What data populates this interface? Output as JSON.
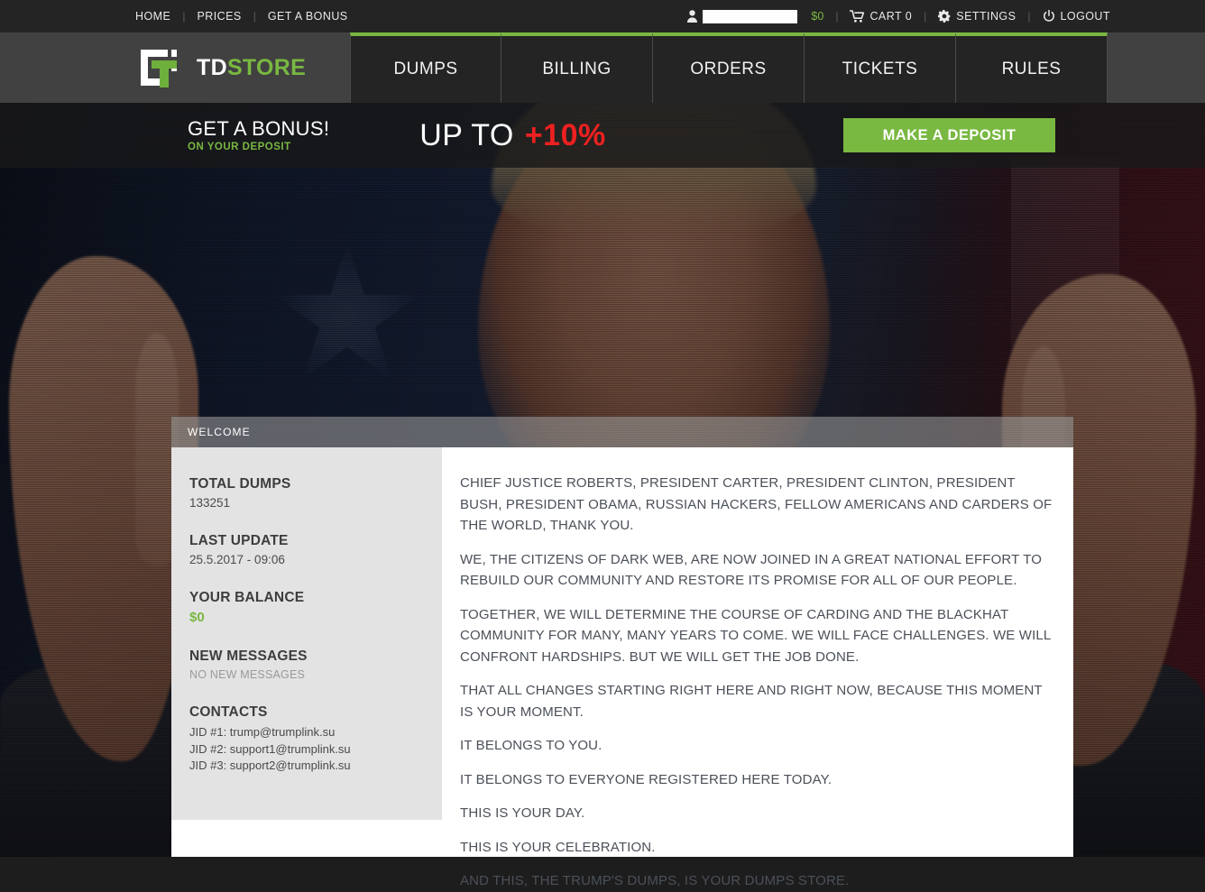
{
  "topbar": {
    "links": [
      {
        "label": "HOME",
        "name": "home"
      },
      {
        "label": "PRICES",
        "name": "prices"
      },
      {
        "label": "GET A BONUS",
        "name": "get-a-bonus"
      }
    ],
    "separator": "|",
    "user": {
      "name_redacted": true,
      "balance": "$0"
    },
    "cart": {
      "label": "CART 0"
    },
    "settings": {
      "label": "SETTINGS"
    },
    "logout": {
      "label": "LOGOUT"
    }
  },
  "logo": {
    "primary": "TD",
    "secondary": "STORE"
  },
  "nav": {
    "tabs": [
      {
        "label": "DUMPS"
      },
      {
        "label": "BILLING"
      },
      {
        "label": "ORDERS"
      },
      {
        "label": "TICKETS"
      },
      {
        "label": "RULES"
      }
    ]
  },
  "banner": {
    "title": "GET A BONUS!",
    "subtitle": "ON YOUR DEPOSIT",
    "upto_label": "UP TO",
    "percent": "+10%",
    "deposit_button": "MAKE A DEPOSIT"
  },
  "panel": {
    "header_title": "WELCOME"
  },
  "sidebar": {
    "blocks": [
      {
        "heading": "TOTAL DUMPS",
        "value": "133251",
        "style": "plain"
      },
      {
        "heading": "LAST UPDATE",
        "value": "25.5.2017 - 09:06",
        "style": "plain"
      },
      {
        "heading": "YOUR BALANCE",
        "value": "$0",
        "style": "green"
      },
      {
        "heading": "NEW MESSAGES",
        "value": "NO NEW MESSAGES",
        "style": "muted"
      }
    ],
    "contacts": {
      "heading": "CONTACTS",
      "lines": [
        "JID #1: trump@trumplink.su",
        "JID #2: support1@trumplink.su",
        "JID #3: support2@trumplink.su"
      ]
    }
  },
  "content": {
    "paragraphs": [
      "CHIEF JUSTICE ROBERTS, PRESIDENT CARTER, PRESIDENT CLINTON, PRESIDENT BUSH, PRESIDENT OBAMA, RUSSIAN HACKERS, FELLOW AMERICANS AND CARDERS OF THE WORLD, THANK YOU.",
      "WE, THE CITIZENS OF DARK WEB, ARE NOW JOINED IN A GREAT NATIONAL EFFORT TO REBUILD OUR COMMUNITY AND RESTORE ITS PROMISE FOR ALL OF OUR PEOPLE.",
      "TOGETHER, WE WILL DETERMINE THE COURSE OF CARDING AND THE BLACKHAT COMMUNITY FOR MANY, MANY YEARS TO COME. WE WILL FACE CHALLENGES. WE WILL CONFRONT HARDSHIPS. BUT WE WILL GET THE JOB DONE.",
      "THAT ALL CHANGES STARTING RIGHT HERE AND RIGHT NOW, BECAUSE THIS MOMENT IS YOUR MOMENT.",
      "IT BELONGS TO YOU.",
      "IT BELONGS TO EVERYONE REGISTERED HERE TODAY.",
      "THIS IS YOUR DAY.",
      "THIS IS YOUR CELEBRATION.",
      "AND THIS, THE TRUMP'S DUMPS, IS YOUR DUMPS STORE."
    ]
  },
  "colors": {
    "accent_green": "#79b841",
    "accent_red": "#ee2020",
    "dark": "#242424",
    "header_gray": "#414141",
    "sidebar_gray": "#e3e3e3"
  }
}
